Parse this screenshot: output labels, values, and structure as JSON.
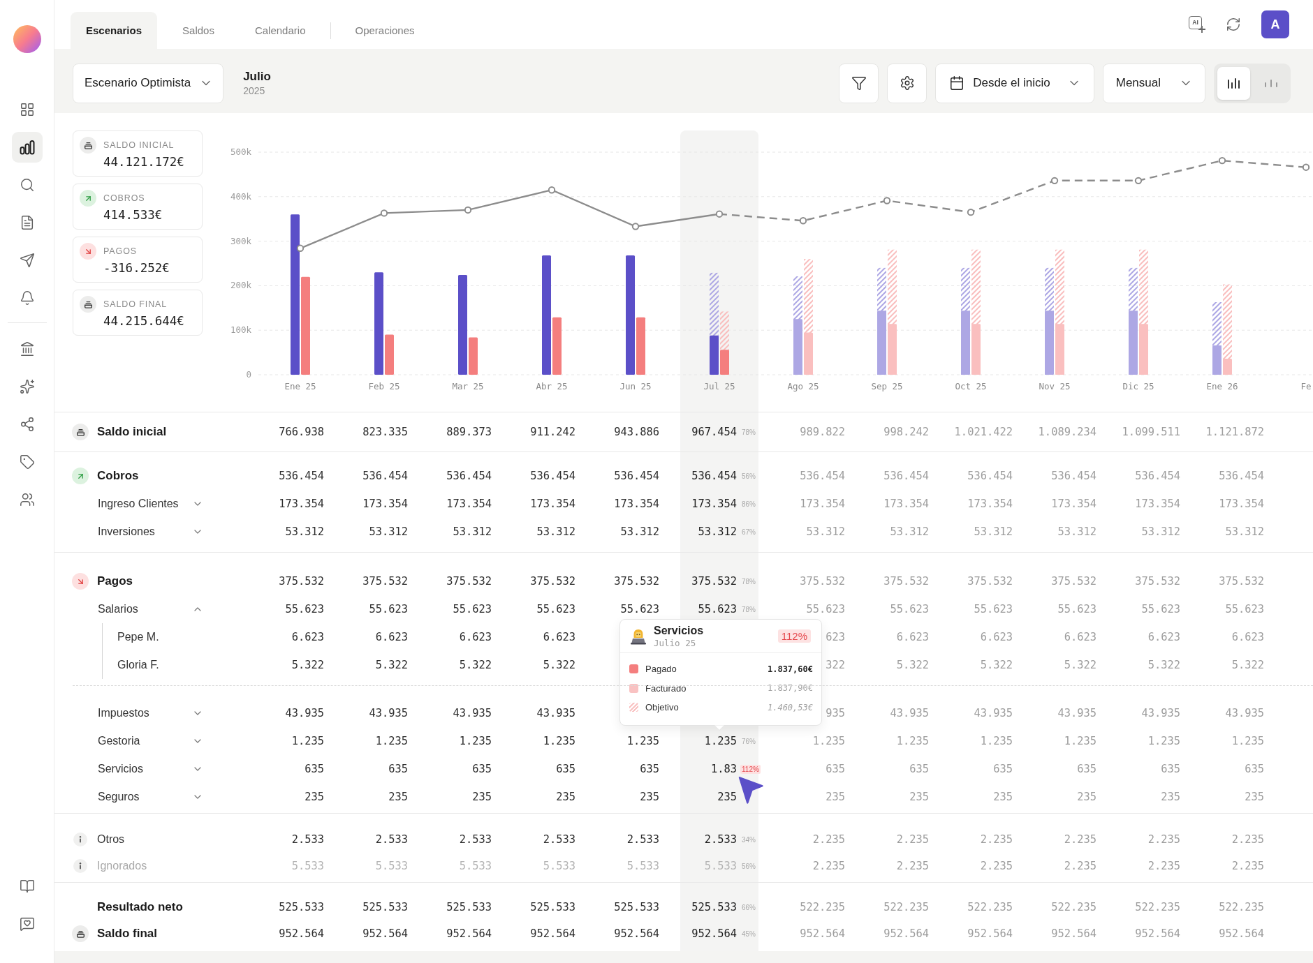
{
  "sidebar": {
    "nav_groups": [
      {
        "items": [
          {
            "selected": false
          },
          {
            "selected": true
          },
          {
            "selected": false
          },
          {
            "selected": false
          },
          {
            "selected": false
          },
          {
            "selected": false
          }
        ]
      },
      {
        "items": [
          {
            "selected": false
          },
          {
            "selected": false
          },
          {
            "selected": false
          },
          {
            "selected": false
          },
          {
            "selected": false
          }
        ]
      }
    ],
    "footer_items": [
      {
        "selected": false
      },
      {
        "selected": false
      }
    ]
  },
  "top_bar": {
    "tab_groups": [
      {
        "tabs": [
          {
            "label": "Escenarios",
            "selected": true
          },
          {
            "label": "Saldos",
            "selected": false
          },
          {
            "label": "Calendario",
            "selected": false
          }
        ]
      },
      {
        "tabs": [
          {
            "label": "Operaciones",
            "selected": false
          }
        ]
      }
    ],
    "ai_label": "AI",
    "avatar_initial": "A"
  },
  "toolbar": {
    "scenario": "Escenario Optimista",
    "period": {
      "month": "Julio",
      "year": "2025"
    },
    "date_range": "Desde el inicio",
    "granularity": "Mensual",
    "view_options": [
      {
        "selected": true
      },
      {
        "selected": false
      }
    ]
  },
  "summary_cards": [
    {
      "kind": "balance",
      "label": "SALDO INICIAL",
      "value": "44.121.172€"
    },
    {
      "kind": "income",
      "label": "COBROS",
      "value": "414.533€"
    },
    {
      "kind": "expense",
      "label": "PAGOS",
      "value": "-316.252€"
    },
    {
      "kind": "balance",
      "label": "SALDO FINAL",
      "value": "44.215.644€"
    }
  ],
  "chart_data": {
    "type": "bar",
    "categories": [
      "Ene 25",
      "Feb 25",
      "Mar 25",
      "Abr 25",
      "Jun 25",
      "Jul 25",
      "Ago 25",
      "Sep 25",
      "Oct 25",
      "Nov 25",
      "Dic 25",
      "Ene 26",
      "Fe"
    ],
    "ylim": [
      0,
      500000
    ],
    "yticks": [
      {
        "value": 0,
        "label": "0"
      },
      {
        "value": 100000,
        "label": "100k"
      },
      {
        "value": 200000,
        "label": "200k"
      },
      {
        "value": 300000,
        "label": "300k"
      },
      {
        "value": 400000,
        "label": "400k"
      },
      {
        "value": 500000,
        "label": "500k"
      }
    ],
    "grid": true,
    "series": [
      {
        "color": "#5b4fc8",
        "values": [
          360000,
          230000,
          224000,
          268000,
          268000,
          88000,
          null,
          null,
          null,
          null,
          null,
          null,
          null
        ]
      },
      {
        "color": "#f47e7e",
        "values": [
          220000,
          90000,
          84000,
          129000,
          129000,
          56000,
          null,
          null,
          null,
          null,
          null,
          null,
          null
        ]
      },
      {
        "color": "#ada7e4",
        "values": [
          null,
          null,
          null,
          null,
          null,
          null,
          125000,
          144000,
          144000,
          144000,
          144000,
          66000,
          null
        ]
      },
      {
        "color": "#fabfbf",
        "values": [
          null,
          null,
          null,
          null,
          null,
          null,
          95000,
          114000,
          114000,
          114000,
          114000,
          36000,
          null
        ]
      },
      {
        "type": "line",
        "marker": "o",
        "color": "#8c8c8c",
        "values": [
          284000,
          363000,
          370000,
          415000,
          333000,
          361000,
          null,
          null,
          null,
          null,
          null,
          null,
          null
        ]
      },
      {
        "type": "line",
        "marker": "o",
        "line_style": "dashed",
        "color": "#8c8c8c",
        "values": [
          null,
          null,
          null,
          null,
          null,
          361000,
          346000,
          391000,
          365000,
          436000,
          436000,
          481000,
          466000
        ]
      }
    ]
  },
  "table": {
    "columns": [
      {
        "selected": false,
        "forecast": false
      },
      {
        "selected": false,
        "forecast": false
      },
      {
        "selected": false,
        "forecast": false
      },
      {
        "selected": false,
        "forecast": false
      },
      {
        "selected": false,
        "forecast": false
      },
      {
        "selected": true,
        "forecast": false
      },
      {
        "selected": false,
        "forecast": true
      },
      {
        "selected": false,
        "forecast": true
      },
      {
        "selected": false,
        "forecast": true
      },
      {
        "selected": false,
        "forecast": true
      },
      {
        "selected": false,
        "forecast": true
      },
      {
        "selected": false,
        "forecast": true
      }
    ],
    "sections": [
      {
        "blocks": [
          {
            "rows": [
              {
                "kind": "balance",
                "label": "Saldo inicial",
                "share": "78%",
                "over_target": false,
                "cells": [
                  "766.938",
                  "823.335",
                  "889.373",
                  "911.242",
                  "943.886",
                  "967.454",
                  "989.822",
                  "998.242",
                  "1.021.422",
                  "1.089.234",
                  "1.099.511",
                  "1.121.872"
                ]
              }
            ]
          }
        ]
      },
      {
        "blocks": [
          {
            "rows": [
              {
                "kind": "income",
                "label": "Cobros",
                "share": "56%",
                "over_target": false,
                "cells": [
                  "536.454",
                  "536.454",
                  "536.454",
                  "536.454",
                  "536.454",
                  "536.454",
                  "536.454",
                  "536.454",
                  "536.454",
                  "536.454",
                  "536.454",
                  "536.454"
                ]
              },
              {
                "kind": "group",
                "label": "Ingreso Clientes",
                "expanded": false,
                "share": "86%",
                "over_target": false,
                "cells": [
                  "173.354",
                  "173.354",
                  "173.354",
                  "173.354",
                  "173.354",
                  "173.354",
                  "173.354",
                  "173.354",
                  "173.354",
                  "173.354",
                  "173.354",
                  "173.354"
                ]
              },
              {
                "kind": "group",
                "label": "Inversiones",
                "expanded": false,
                "share": "67%",
                "over_target": false,
                "cells": [
                  "53.312",
                  "53.312",
                  "53.312",
                  "53.312",
                  "53.312",
                  "53.312",
                  "53.312",
                  "53.312",
                  "53.312",
                  "53.312",
                  "53.312",
                  "53.312"
                ]
              }
            ]
          }
        ]
      },
      {
        "blocks": [
          {
            "rows": [
              {
                "kind": "expense",
                "label": "Pagos",
                "share": "78%",
                "over_target": false,
                "cells": [
                  "375.532",
                  "375.532",
                  "375.532",
                  "375.532",
                  "375.532",
                  "375.532",
                  "375.532",
                  "375.532",
                  "375.532",
                  "375.532",
                  "375.532",
                  "375.532"
                ]
              },
              {
                "kind": "group",
                "label": "Salarios",
                "expanded": true,
                "share": "78%",
                "over_target": false,
                "cells": [
                  "55.623",
                  "55.623",
                  "55.623",
                  "55.623",
                  "55.623",
                  "55.623",
                  "55.623",
                  "55.623",
                  "55.623",
                  "55.623",
                  "55.623",
                  "55.623"
                ],
                "children": [
                  {
                    "label": "Pepe M.",
                    "cells": [
                      "6.623",
                      "6.623",
                      "6.623",
                      "6.623",
                      null,
                      null,
                      "623",
                      "6.623",
                      "6.623",
                      "6.623",
                      "6.623",
                      "6.623"
                    ]
                  },
                  {
                    "label": "Gloria F.",
                    "cells": [
                      "5.322",
                      "5.322",
                      "5.322",
                      "5.322",
                      null,
                      null,
                      "322",
                      "5.322",
                      "5.322",
                      "5.322",
                      "5.322",
                      "5.322"
                    ]
                  }
                ]
              }
            ]
          },
          {
            "rows": [
              {
                "kind": "group",
                "label": "Impuestos",
                "expanded": false,
                "cells": [
                  "43.935",
                  "43.935",
                  "43.935",
                  "43.935",
                  null,
                  null,
                  "935",
                  "43.935",
                  "43.935",
                  "43.935",
                  "43.935",
                  "43.935"
                ]
              },
              {
                "kind": "group",
                "label": "Gestoria",
                "expanded": false,
                "share": "76%",
                "over_target": false,
                "cells": [
                  "1.235",
                  "1.235",
                  "1.235",
                  "1.235",
                  "1.235",
                  "1.235",
                  "1.235",
                  "1.235",
                  "1.235",
                  "1.235",
                  "1.235",
                  "1.235"
                ]
              },
              {
                "kind": "group",
                "label": "Servicios",
                "expanded": false,
                "share": "112%",
                "over_target": true,
                "cells": [
                  "635",
                  "635",
                  "635",
                  "635",
                  "635",
                  "1.83",
                  "635",
                  "635",
                  "635",
                  "635",
                  "635",
                  "635"
                ]
              },
              {
                "kind": "group",
                "label": "Seguros",
                "expanded": false,
                "cells": [
                  "235",
                  "235",
                  "235",
                  "235",
                  "235",
                  "235",
                  "235",
                  "235",
                  "235",
                  "235",
                  "235",
                  "235"
                ]
              }
            ]
          }
        ]
      },
      {
        "blocks": [
          {
            "rows": [
              {
                "kind": "note",
                "label": "Otros",
                "muted": false,
                "share": "34%",
                "over_target": false,
                "cells": [
                  "2.533",
                  "2.533",
                  "2.533",
                  "2.533",
                  "2.533",
                  "2.533",
                  "2.235",
                  "2.235",
                  "2.235",
                  "2.235",
                  "2.235",
                  "2.235"
                ]
              },
              {
                "kind": "note",
                "label": "Ignorados",
                "muted": true,
                "share": "56%",
                "over_target": false,
                "cells": [
                  "5.533",
                  "5.533",
                  "5.533",
                  "5.533",
                  "5.533",
                  "5.533",
                  "2.235",
                  "2.235",
                  "2.235",
                  "2.235",
                  "2.235",
                  "2.235"
                ]
              }
            ]
          }
        ]
      },
      {
        "blocks": [
          {
            "rows": [
              {
                "kind": "total",
                "label": "Resultado neto",
                "share": "66%",
                "over_target": false,
                "cells": [
                  "525.533",
                  "525.533",
                  "525.533",
                  "525.533",
                  "525.533",
                  "525.533",
                  "522.235",
                  "522.235",
                  "522.235",
                  "522.235",
                  "522.235",
                  "522.235"
                ]
              },
              {
                "kind": "balance",
                "label": "Saldo final",
                "share": "45%",
                "over_target": false,
                "cells": [
                  "952.564",
                  "952.564",
                  "952.564",
                  "952.564",
                  "952.564",
                  "952.564",
                  "952.564",
                  "952.564",
                  "952.564",
                  "952.564",
                  "952.564",
                  "952.564"
                ]
              }
            ]
          }
        ]
      }
    ]
  },
  "tooltip": {
    "title": "Servicios",
    "subtitle": "Julio 25",
    "badge": "112%",
    "over_target": true,
    "items": [
      {
        "kind": "paid",
        "label": "Pagado",
        "value": "1.837,60€"
      },
      {
        "kind": "invoiced",
        "label": "Facturado",
        "value": "1.837,90€"
      },
      {
        "kind": "target",
        "label": "Objetivo",
        "value": "1.460,53€"
      }
    ]
  }
}
